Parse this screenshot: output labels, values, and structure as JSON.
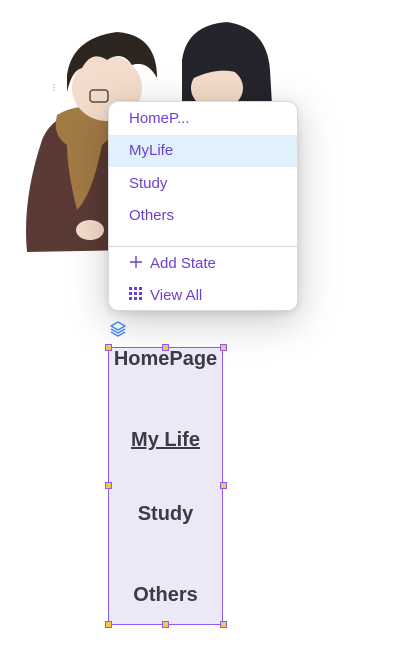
{
  "menu": {
    "states": [
      {
        "label": "HomeP...",
        "selected": false
      },
      {
        "label": "MyLife",
        "selected": true
      },
      {
        "label": "Study",
        "selected": false
      },
      {
        "label": "Others",
        "selected": false
      }
    ],
    "add_state_label": "Add State",
    "view_all_label": "View All",
    "icons": {
      "add": "plus-icon",
      "view_all": "grid-icon"
    }
  },
  "canvas": {
    "nav_items": [
      "HomePage",
      "My Life",
      "Study",
      "Others"
    ],
    "layers_icon": "layers-icon"
  },
  "colors": {
    "accent": "#6d3fd1",
    "selection_border": "#8b5cf6",
    "selected_row_bg": "#e0f1fc",
    "frame_fill": "#ede8f7",
    "handle": "#f5c842",
    "nav_text": "#3a3a48"
  }
}
